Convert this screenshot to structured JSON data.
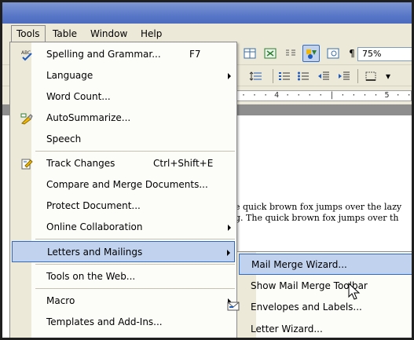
{
  "menubar": {
    "tools": "Tools",
    "table": "Table",
    "window": "Window",
    "help": "Help"
  },
  "toolbar": {
    "zoom": "75%",
    "pilcrow": "¶"
  },
  "ruler": {
    "marks": "· · · 4 · · · · | · · · · 5 · · · · | · · · · ·"
  },
  "document": {
    "line1": "e quick brown fox jumps over the lazy",
    "line2": "g.  The quick brown fox jumps over th"
  },
  "tools_menu": {
    "items": [
      {
        "label": "Spelling and Grammar...",
        "shortcut": "F7",
        "icon": "spelling-icon"
      },
      {
        "label": "Language",
        "submenu": true
      },
      {
        "label": "Word Count..."
      },
      {
        "label": "AutoSummarize...",
        "icon": "autosummarize-icon"
      },
      {
        "label": "Speech"
      },
      {
        "label": "Track Changes",
        "shortcut": "Ctrl+Shift+E",
        "icon": "track-changes-icon"
      },
      {
        "label": "Compare and Merge Documents..."
      },
      {
        "label": "Protect Document..."
      },
      {
        "label": "Online Collaboration",
        "submenu": true
      },
      {
        "label": "Letters and Mailings",
        "submenu": true,
        "highlighted": true
      },
      {
        "label": "Tools on the Web..."
      },
      {
        "label": "Macro",
        "submenu": true
      },
      {
        "label": "Templates and Add-Ins..."
      }
    ]
  },
  "submenu": {
    "items": [
      {
        "label": "Mail Merge Wizard...",
        "highlighted": true
      },
      {
        "label": "Show Mail Merge Toolbar"
      },
      {
        "label": "Envelopes and Labels...",
        "icon": "envelope-icon"
      },
      {
        "label": "Letter Wizard..."
      }
    ]
  },
  "colors": {
    "highlight_fill": "#c1d2ee",
    "highlight_border": "#316ac5",
    "menu_gutter": "#ece9d8",
    "title_bar": "#5a78c8"
  }
}
